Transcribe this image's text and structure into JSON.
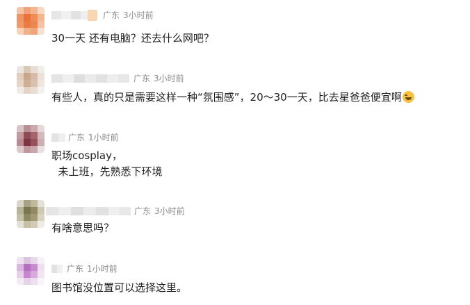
{
  "comments": [
    {
      "location": "广东",
      "time": "3小时前",
      "text_line1": "30一天 还有电脑？还去什么网吧？",
      "text_line2": "",
      "emoji": ""
    },
    {
      "location": "广东",
      "time": "3小时前",
      "text_line1": "有些人，真的只是需要这样一种“氛围感”，20～30一天，比去星爸爸便宜啊",
      "text_line2": "",
      "emoji": "laughing-tears-emoji"
    },
    {
      "location": "广东",
      "time": "1小时前",
      "text_line1": "职场cosplay，",
      "text_line2": "  未上班，先熟悉下环境",
      "emoji": ""
    },
    {
      "location": "广东",
      "time": "3小时前",
      "text_line1": "有啥意思吗？",
      "text_line2": "",
      "emoji": ""
    },
    {
      "location": "广东",
      "time": "1小时前",
      "text_line1": "图书馆没位置可以选择这里。",
      "text_line2": "",
      "emoji": ""
    }
  ]
}
